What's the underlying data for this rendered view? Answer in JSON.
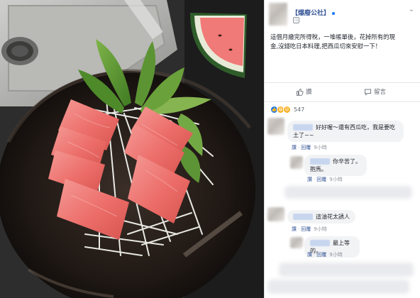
{
  "post": {
    "page_name": "【爆廢公社】",
    "time_icon": "clock-icon",
    "text_line1": "這個月繳完所得稅，一堆帳單後，花掉所有的現",
    "text_line2": "金,沒錢吃日本料理,把西瓜切來安慰一下！"
  },
  "actions": {
    "like_label": "讚",
    "comment_label": "留言"
  },
  "reactions": {
    "icons": [
      "like-icon",
      "haha-icon",
      "wow-icon"
    ],
    "count": "547",
    "colors": {
      "like": "#1877f2",
      "haha": "#f7b125"
    }
  },
  "comments": [
    {
      "text_line1": "好好喔～還有西瓜吃，我是要吃",
      "text_line2": "土了~~",
      "like": "讚",
      "reply": "回覆",
      "time": "9小時"
    },
    {
      "text_line1": "你辛苦了。",
      "text_line2": "抱馬。",
      "like": "讚",
      "reply": "回覆",
      "time": "9小時"
    },
    {
      "text": "這油花太誘人",
      "like": "讚",
      "reply": "回覆",
      "time": "9小時"
    },
    {
      "text": "最上等的。",
      "like": "讚",
      "reply": "回覆",
      "time": "9小時"
    }
  ]
}
